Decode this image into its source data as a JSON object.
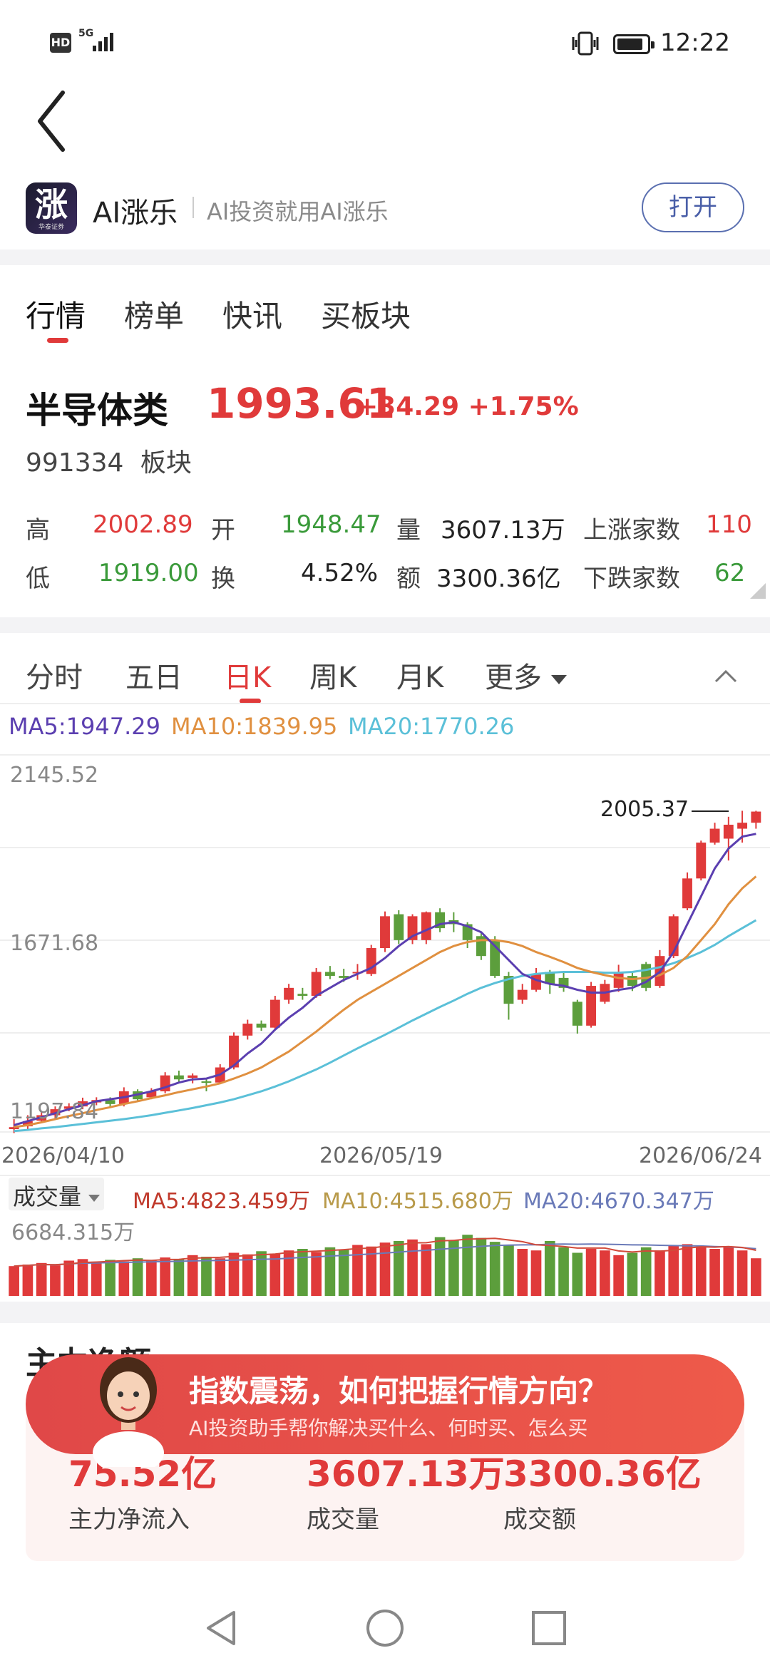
{
  "status": {
    "hd": "HD",
    "net": "5G",
    "time": "12:22"
  },
  "banner": {
    "app_name": "AI涨乐",
    "slogan": "AI投资就用AI涨乐",
    "open_label": "打开",
    "logo_char": "涨",
    "logo_small": "华泰证券"
  },
  "tabs": [
    {
      "label": "行情"
    },
    {
      "label": "榜单"
    },
    {
      "label": "快讯"
    },
    {
      "label": "买板块"
    }
  ],
  "index": {
    "name": "半导体类",
    "price": "1993.61",
    "change": "+34.29",
    "change_pct": "+1.75%",
    "code": "991334",
    "type": "板块"
  },
  "stats": {
    "high_label": "高",
    "high": "2002.89",
    "open_label": "开",
    "open": "1948.47",
    "volume_label": "量",
    "volume": "3607.13万",
    "up_label": "上涨家数",
    "up": "110",
    "low_label": "低",
    "low": "1919.00",
    "turnover_label": "换",
    "turnover": "4.52%",
    "amount_label": "额",
    "amount": "3300.36亿",
    "down_label": "下跌家数",
    "down": "62"
  },
  "chart_tabs": [
    {
      "label": "分时"
    },
    {
      "label": "五日"
    },
    {
      "label": "日K"
    },
    {
      "label": "周K"
    },
    {
      "label": "月K"
    },
    {
      "label": "更多"
    }
  ],
  "ma": {
    "ma5": "MA5:1947.29",
    "ma10": "MA10:1839.95",
    "ma20": "MA20:1770.26"
  },
  "colors": {
    "up": "#e03a3a",
    "down": "#5c9e3c",
    "ma5": "#5b3fb0",
    "ma10": "#e09040",
    "ma20": "#5bc0d8",
    "vol_ma20": "#6a7ab8"
  },
  "chart_data": {
    "type": "candlestick",
    "y_ticks": [
      "2145.52",
      "1671.68",
      "1197.84"
    ],
    "ylim": [
      1197.84,
      2145.52
    ],
    "x_ticks": [
      "2026/04/10",
      "2026/05/19",
      "2026/06/24"
    ],
    "max_label": "2005.37",
    "candles": [
      [
        1205,
        1210,
        1230,
        1195
      ],
      [
        1212,
        1225,
        1240,
        1205
      ],
      [
        1226,
        1240,
        1250,
        1220
      ],
      [
        1240,
        1255,
        1262,
        1232
      ],
      [
        1256,
        1262,
        1270,
        1250
      ],
      [
        1262,
        1275,
        1284,
        1255
      ],
      [
        1272,
        1278,
        1285,
        1265
      ],
      [
        1278,
        1268,
        1285,
        1262
      ],
      [
        1268,
        1300,
        1310,
        1262
      ],
      [
        1300,
        1280,
        1305,
        1276
      ],
      [
        1285,
        1300,
        1308,
        1280
      ],
      [
        1300,
        1340,
        1348,
        1295
      ],
      [
        1340,
        1330,
        1352,
        1324
      ],
      [
        1334,
        1340,
        1345,
        1320
      ],
      [
        1325,
        1322,
        1330,
        1300
      ],
      [
        1322,
        1360,
        1368,
        1318
      ],
      [
        1360,
        1440,
        1448,
        1355
      ],
      [
        1440,
        1470,
        1480,
        1430
      ],
      [
        1470,
        1460,
        1478,
        1452
      ],
      [
        1460,
        1530,
        1540,
        1455
      ],
      [
        1530,
        1560,
        1570,
        1520
      ],
      [
        1545,
        1540,
        1560,
        1530
      ],
      [
        1540,
        1600,
        1610,
        1535
      ],
      [
        1600,
        1590,
        1615,
        1582
      ],
      [
        1590,
        1585,
        1608,
        1575
      ],
      [
        1600,
        1600,
        1620,
        1580
      ],
      [
        1595,
        1660,
        1668,
        1590
      ],
      [
        1660,
        1740,
        1752,
        1650
      ],
      [
        1745,
        1680,
        1755,
        1670
      ],
      [
        1680,
        1740,
        1745,
        1670
      ],
      [
        1680,
        1750,
        1752,
        1670
      ],
      [
        1750,
        1710,
        1760,
        1700
      ],
      [
        1730,
        1720,
        1750,
        1700
      ],
      [
        1720,
        1680,
        1725,
        1660
      ],
      [
        1690,
        1640,
        1700,
        1630
      ],
      [
        1680,
        1590,
        1690,
        1585
      ],
      [
        1590,
        1520,
        1600,
        1480
      ],
      [
        1530,
        1555,
        1570,
        1520
      ],
      [
        1555,
        1595,
        1610,
        1550
      ],
      [
        1600,
        1570,
        1605,
        1545
      ],
      [
        1585,
        1560,
        1600,
        1550
      ],
      [
        1525,
        1465,
        1530,
        1445
      ],
      [
        1465,
        1565,
        1575,
        1460
      ],
      [
        1525,
        1570,
        1580,
        1520
      ],
      [
        1560,
        1600,
        1618,
        1550
      ],
      [
        1590,
        1565,
        1600,
        1552
      ],
      [
        1620,
        1560,
        1625,
        1552
      ],
      [
        1565,
        1640,
        1655,
        1560
      ],
      [
        1640,
        1740,
        1745,
        1635
      ],
      [
        1760,
        1835,
        1850,
        1755
      ],
      [
        1835,
        1925,
        1930,
        1830
      ],
      [
        1925,
        1960,
        1975,
        1920
      ],
      [
        1935,
        1970,
        1990,
        1880
      ],
      [
        1960,
        1975,
        2005,
        1925
      ],
      [
        1975,
        2003,
        2005,
        1960
      ]
    ],
    "ma5": [
      1215,
      1225,
      1235,
      1245,
      1255,
      1265,
      1275,
      1280,
      1285,
      1292,
      1300,
      1310,
      1322,
      1330,
      1332,
      1342,
      1365,
      1395,
      1420,
      1455,
      1485,
      1510,
      1540,
      1560,
      1580,
      1595,
      1610,
      1635,
      1665,
      1690,
      1705,
      1720,
      1725,
      1715,
      1700,
      1665,
      1630,
      1595,
      1580,
      1570,
      1565,
      1555,
      1548,
      1548,
      1555,
      1560,
      1575,
      1600,
      1650,
      1720,
      1790,
      1860,
      1910,
      1940,
      1947
    ],
    "ma10": [
      1210,
      1215,
      1222,
      1230,
      1238,
      1245,
      1253,
      1260,
      1268,
      1275,
      1283,
      1290,
      1298,
      1305,
      1312,
      1320,
      1332,
      1345,
      1360,
      1380,
      1400,
      1425,
      1450,
      1478,
      1505,
      1530,
      1550,
      1570,
      1590,
      1610,
      1630,
      1650,
      1665,
      1675,
      1680,
      1680,
      1675,
      1665,
      1650,
      1638,
      1625,
      1610,
      1600,
      1592,
      1585,
      1582,
      1585,
      1592,
      1610,
      1640,
      1680,
      1720,
      1770,
      1810,
      1840
    ],
    "ma20": [
      1200,
      1203,
      1207,
      1210,
      1214,
      1218,
      1222,
      1226,
      1230,
      1235,
      1240,
      1246,
      1252,
      1258,
      1265,
      1272,
      1280,
      1290,
      1300,
      1312,
      1325,
      1340,
      1355,
      1372,
      1390,
      1408,
      1425,
      1442,
      1460,
      1478,
      1495,
      1512,
      1528,
      1545,
      1560,
      1572,
      1582,
      1590,
      1595,
      1598,
      1600,
      1600,
      1600,
      1598,
      1598,
      1600,
      1605,
      1612,
      1622,
      1635,
      1650,
      1668,
      1690,
      1710,
      1730
    ]
  },
  "volume": {
    "label": "成交量",
    "max_label": "6684.315万",
    "ma5": "MA5:4823.459万",
    "ma10": "MA10:4515.680万",
    "ma20": "MA20:4670.347万",
    "bars": [
      38,
      40,
      42,
      39,
      45,
      47,
      43,
      46,
      44,
      48,
      45,
      49,
      47,
      52,
      50,
      48,
      55,
      53,
      57,
      54,
      58,
      60,
      56,
      62,
      59,
      65,
      63,
      68,
      70,
      72,
      66,
      75,
      71,
      78,
      74,
      69,
      65,
      60,
      58,
      70,
      62,
      55,
      60,
      58,
      52,
      55,
      62,
      58,
      64,
      66,
      63,
      60,
      62,
      58,
      48
    ]
  },
  "promo": {
    "title": "指数震荡，如何把握行情方向？",
    "subtitle": "AI投资助手帮你解决买什么、何时买、怎么买"
  },
  "bottom_stats": [
    {
      "value": "75.52亿",
      "label": "主力净流入"
    },
    {
      "value": "3607.13万",
      "label": "成交量"
    },
    {
      "value": "3300.36亿",
      "label": "成交额"
    }
  ],
  "section_title": "主力净额"
}
